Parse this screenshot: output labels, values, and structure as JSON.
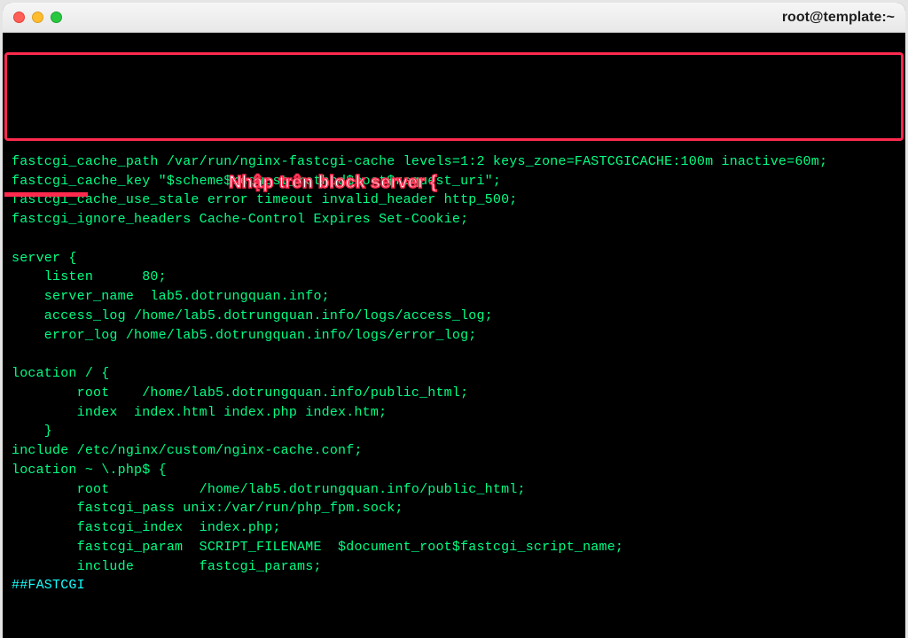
{
  "window": {
    "title": "root@template:~"
  },
  "annotation": "Nhập trên block server {",
  "lines": [
    "fastcgi_cache_path /var/run/nginx-fastcgi-cache levels=1:2 keys_zone=FASTCGICACHE:100m inactive=60m;",
    "fastcgi_cache_key \"$scheme$request_method$host$request_uri\";",
    "fastcgi_cache_use_stale error timeout invalid_header http_500;",
    "fastcgi_ignore_headers Cache-Control Expires Set-Cookie;",
    "",
    "server {",
    "    listen      80;",
    "    server_name  lab5.dotrungquan.info;",
    "    access_log /home/lab5.dotrungquan.info/logs/access_log;",
    "    error_log /home/lab5.dotrungquan.info/logs/error_log;",
    "",
    "location / {",
    "        root    /home/lab5.dotrungquan.info/public_html;",
    "        index  index.html index.php index.htm;",
    "    }",
    "include /etc/nginx/custom/nginx-cache.conf;",
    "location ~ \\.php$ {",
    "        root           /home/lab5.dotrungquan.info/public_html;",
    "        fastcgi_pass unix:/var/run/php_fpm.sock;",
    "        fastcgi_index  index.php;",
    "        fastcgi_param  SCRIPT_FILENAME  $document_root$fastcgi_script_name;",
    "        include        fastcgi_params;"
  ],
  "footer": "##FASTCGI"
}
